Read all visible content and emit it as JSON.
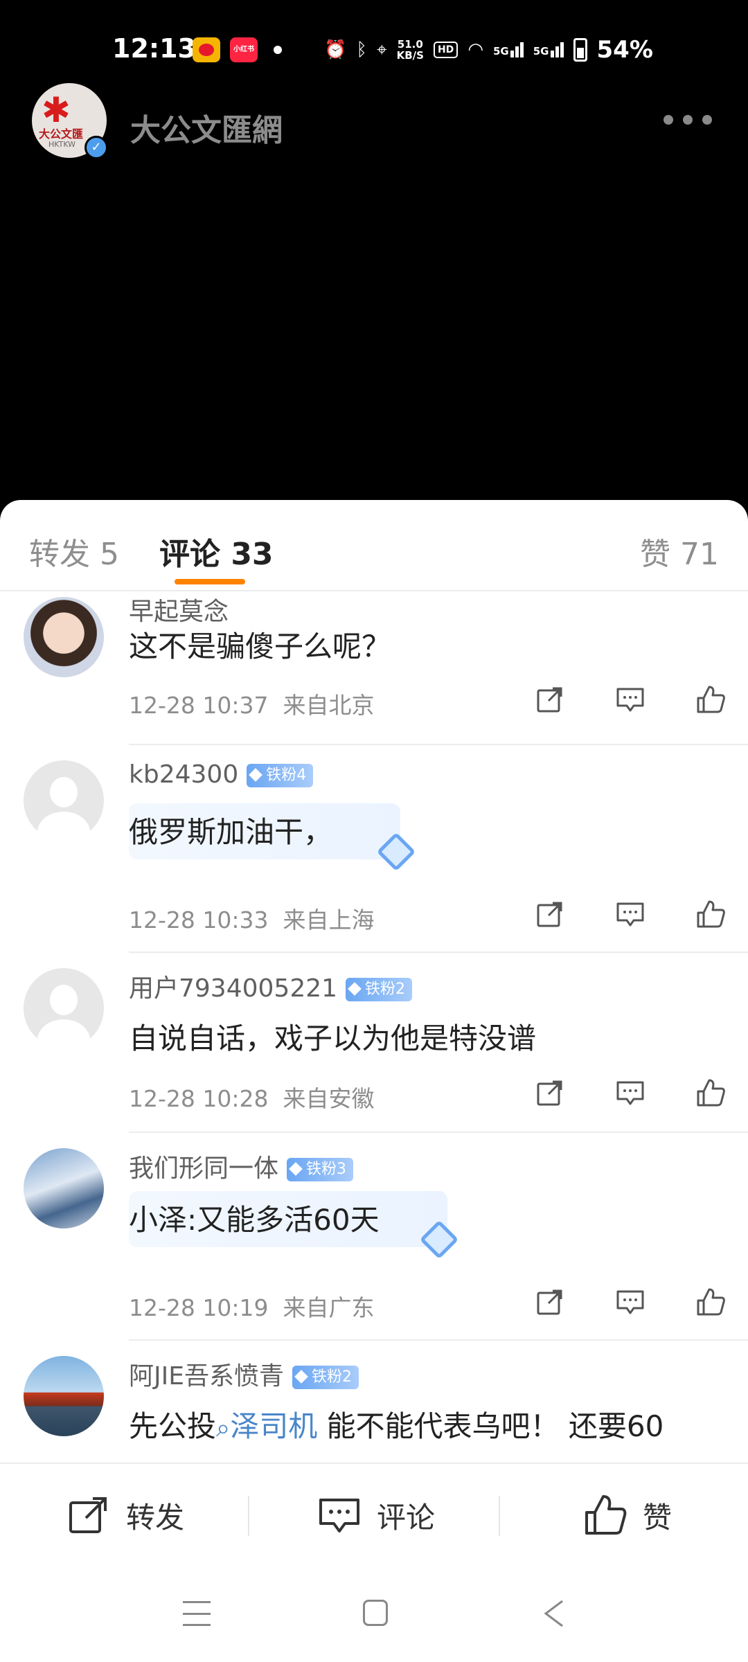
{
  "status_bar": {
    "time": "12:13",
    "net_speed_value": "51.0",
    "net_speed_unit": "KB/S",
    "hd_label": "HD",
    "signal1_label": "5G",
    "signal2_label": "5G",
    "battery_percent": "54%",
    "app_icon_2_label": "小红书"
  },
  "header": {
    "account_logo_brand": "大公文匯",
    "account_logo_sub": "HKTKW",
    "account_name": "大公文匯網",
    "verified_mark": "✓"
  },
  "tabs": {
    "repost": "转发 5",
    "comments": "评论 33",
    "likes": "赞 71"
  },
  "comments": [
    {
      "user": "早起莫念",
      "badge": "",
      "text": "这不是骗傻子么呢？",
      "time": "12-28 10:37",
      "location": "来自北京"
    },
    {
      "user": "kb24300",
      "badge": "铁粉4",
      "text": "俄罗斯加油干，",
      "time": "12-28 10:33",
      "location": "来自上海"
    },
    {
      "user": "用户7934005221",
      "badge": "铁粉2",
      "text": "自说自话，戏子以为他是特没谱",
      "time": "12-28 10:28",
      "location": "来自安徽"
    },
    {
      "user": "我们形同一体",
      "badge": "铁粉3",
      "text": "小泽:又能多活60天",
      "time": "12-28 10:19",
      "location": "来自广东"
    },
    {
      "user": "阿JIE吾系愤青",
      "badge": "铁粉2",
      "text_before": "先公投",
      "mention": "泽司机",
      "text_after": " 能不能代表乌吧！ 还要60"
    }
  ],
  "bottom_bar": {
    "repost": "转发",
    "comment": "评论",
    "like": "赞"
  }
}
